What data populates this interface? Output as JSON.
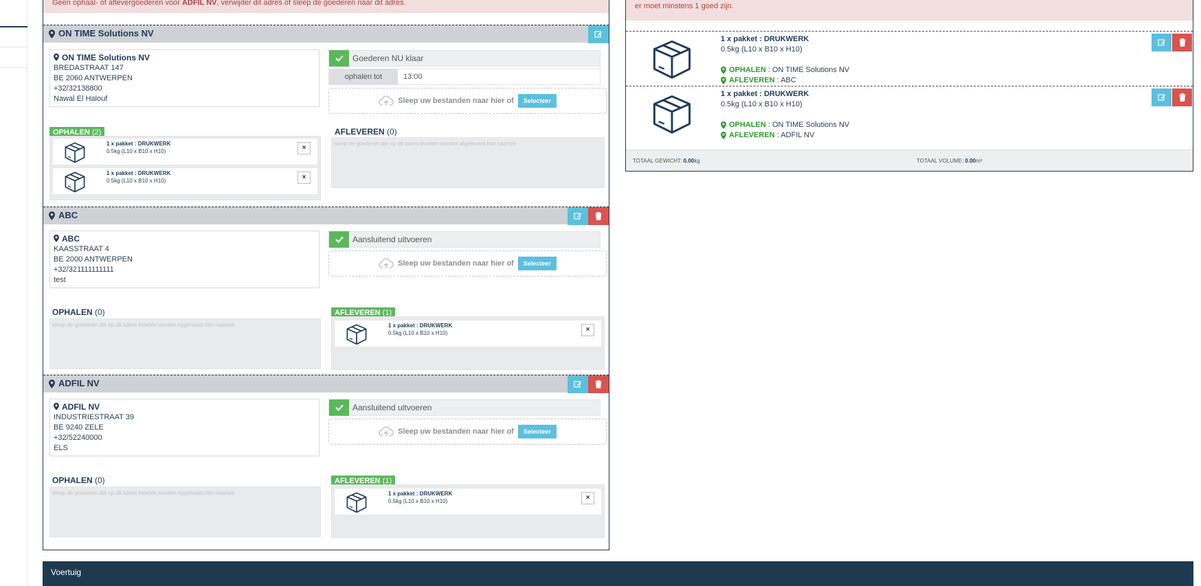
{
  "alert_left": {
    "prefix": "Geen ophaal- of aflevergoederen voor",
    "name": "ADFIL NV",
    "suffix": ", verwijder dit adres of sleep de goederen naar dit adres."
  },
  "alert_right": "er moet minstens 1 goed zijn.",
  "icons": {
    "pin": "map-marker-icon",
    "edit": "edit-icon",
    "delete": "trash-icon",
    "check": "check-icon",
    "upload": "cloud-upload-icon",
    "box": "package-box-icon",
    "close": "close-icon"
  },
  "colors": {
    "navy": "#1f3a5a",
    "green": "#5cb85c",
    "info": "#5bc0de",
    "danger": "#d9534f",
    "alert_bg": "#f2dede"
  },
  "common": {
    "upload_text": "Sleep uw bestanden naar hier of",
    "select_label": "Selecteer",
    "ophalen_label": "OPHALEN",
    "afleveren_label": "AFLEVEREN",
    "ophalen_placeholder": "sleep de goederen die op dit adres moeten worden opgehaald hier naartoe",
    "afleveren_placeholder": "sleep de goederen die op dit adres moeten worden afgeleverd hier naartoe",
    "close_glyph": "×"
  },
  "stops": [
    {
      "header": "ON TIME Solutions NV",
      "address": {
        "name": "ON TIME Solutions NV",
        "street": "BREDASTRAAT 147",
        "city": "BE 2060 ANTWERPEN",
        "phone": "+32/32138800",
        "contact": "Nawal El Halouf"
      },
      "status": "Goederen NU klaar",
      "time_label": "ophalen tot",
      "time_value": "13:00",
      "ophalen_count": "(2)",
      "afleveren_count": "(0)",
      "ophalen_items": [
        {
          "title": "1 x pakket : DRUKWERK",
          "size": "0.5kg (L10 x B10 x H10)"
        },
        {
          "title": "1 x pakket : DRUKWERK",
          "size": "0.5kg (L10 x B10 x H10)"
        }
      ]
    },
    {
      "header": "ABC",
      "address": {
        "name": "ABC",
        "street": "KAASSTRAAT 4",
        "city": "BE 2000 ANTWERPEN",
        "phone": "+32/321111111111",
        "contact": "test"
      },
      "status": "Aansluitend uitvoeren",
      "ophalen_count": "(0)",
      "afleveren_count": "(1)",
      "afleveren_items": [
        {
          "title": "1 x pakket : DRUKWERK",
          "size": "0.5kg (L10 x B10 x H10)"
        }
      ]
    },
    {
      "header": "ADFIL NV",
      "address": {
        "name": "ADFIL NV",
        "street": "INDUSTRIESTRAAT 39",
        "city": "BE 9240 ZELE",
        "phone": "+32/52240000",
        "contact": "ELS"
      },
      "status": "Aansluitend uitvoeren",
      "ophalen_count": "(0)",
      "afleveren_count": "(1)",
      "afleveren_items": [
        {
          "title": "1 x pakket : DRUKWERK",
          "size": "0.5kg (L10 x B10 x H10)"
        }
      ]
    }
  ],
  "goods": [
    {
      "title": "1 x pakket : DRUKWERK",
      "size": "0.5kg (L10 x B10 x H10)",
      "ophalen_label": "OPHALEN",
      "ophalen_value": ": ON TIME Solutions NV",
      "afleveren_label": "AFLEVEREN",
      "afleveren_value": ": ABC"
    },
    {
      "title": "1 x pakket : DRUKWERK",
      "size": "0.5kg (L10 x B10 x H10)",
      "ophalen_label": "OPHALEN",
      "ophalen_value": ": ON TIME Solutions NV",
      "afleveren_label": "AFLEVEREN",
      "afleveren_value": ": ADFIL NV"
    }
  ],
  "totals": {
    "weight_label": "TOTAAL GEWICHT:",
    "weight_value": "0.00",
    "weight_unit": "kg",
    "volume_label": "TOTAAL VOLUME:",
    "volume_value": "0.00",
    "volume_unit": "m³"
  },
  "vehicle_section": "Voertuig"
}
